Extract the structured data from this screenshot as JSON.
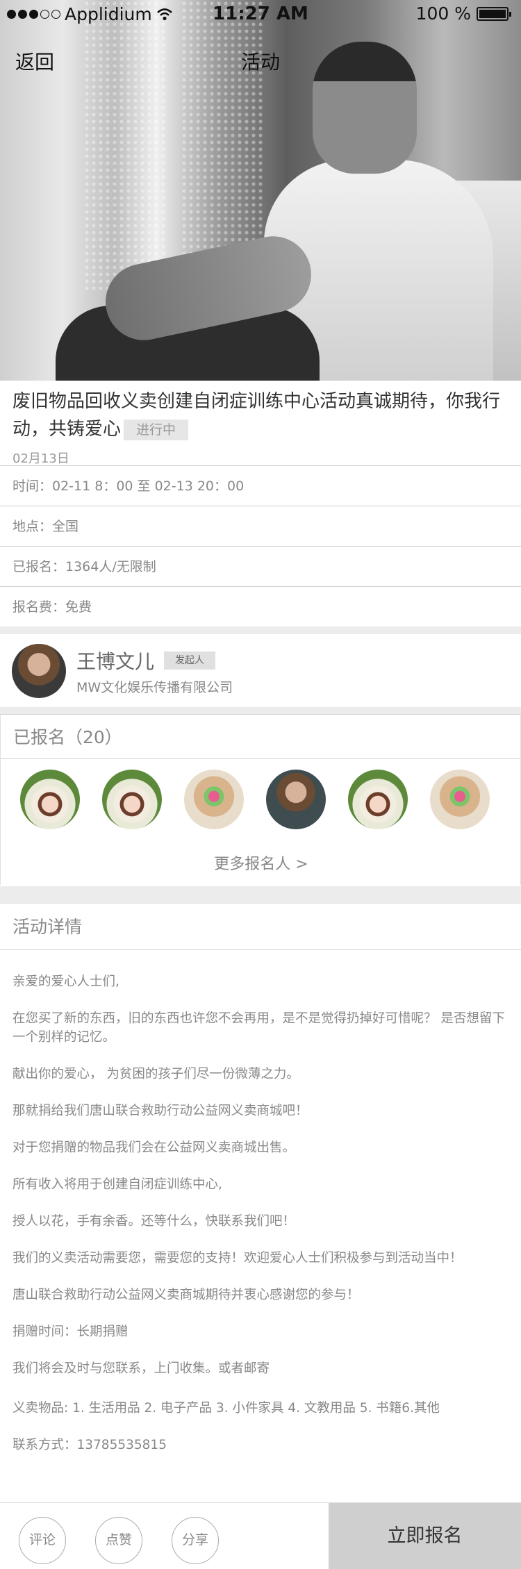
{
  "status_bar": {
    "carrier": "Applidium",
    "time": "11:27 AM",
    "battery": "100 %"
  },
  "navbar": {
    "back_label": "返回",
    "title": "活动"
  },
  "event": {
    "title": "废旧物品回收义卖创建自闭症训练中心活动真诚期待，你我行动，共铸爱心",
    "status": "进行中",
    "date": "02月13日",
    "info": [
      "时间：02-11 8：00 至 02-13 20：00",
      "地点：全国",
      "已报名：1364人/无限制",
      "报名费：免费"
    ]
  },
  "organizer": {
    "name": "王博文儿",
    "tag": "发起人",
    "company": "MW文化娱乐传播有限公司"
  },
  "registered": {
    "header": "已报名（20）",
    "more_label": "更多报名人 >"
  },
  "details": {
    "header": "活动详情",
    "paragraphs": [
      "亲爱的爱心人士们,",
      "在您买了新的东西，旧的东西也许您不会再用，是不是觉得扔掉好可惜呢？ 是否想留下一个别样的记忆。",
      "献出你的爱心， 为贫困的孩子们尽一份微薄之力。",
      "那就捐给我们唐山联合救助行动公益网义卖商城吧！",
      "对于您捐赠的物品我们会在公益网义卖商城出售。",
      "所有收入将用于创建自闭症训练中心,",
      "授人以花，手有余香。还等什么，快联系我们吧！",
      "我们的义卖活动需要您，需要您的支持！欢迎爱心人士们积极参与到活动当中！",
      "唐山联合救助行动公益网义卖商城期待并衷心感谢您的参与！",
      "捐赠时间：长期捐赠",
      "我们将会及时与您联系，上门收集。或者邮寄",
      "义卖物品: 1. 生活用品 2. 电子产品 3. 小件家具 4. 文教用品 5. 书籍6.其他",
      "联系方式：13785535815"
    ]
  },
  "bottom_bar": {
    "comment_label": "评论",
    "like_label": "点赞",
    "share_label": "分享",
    "signup_label": "立即报名"
  }
}
